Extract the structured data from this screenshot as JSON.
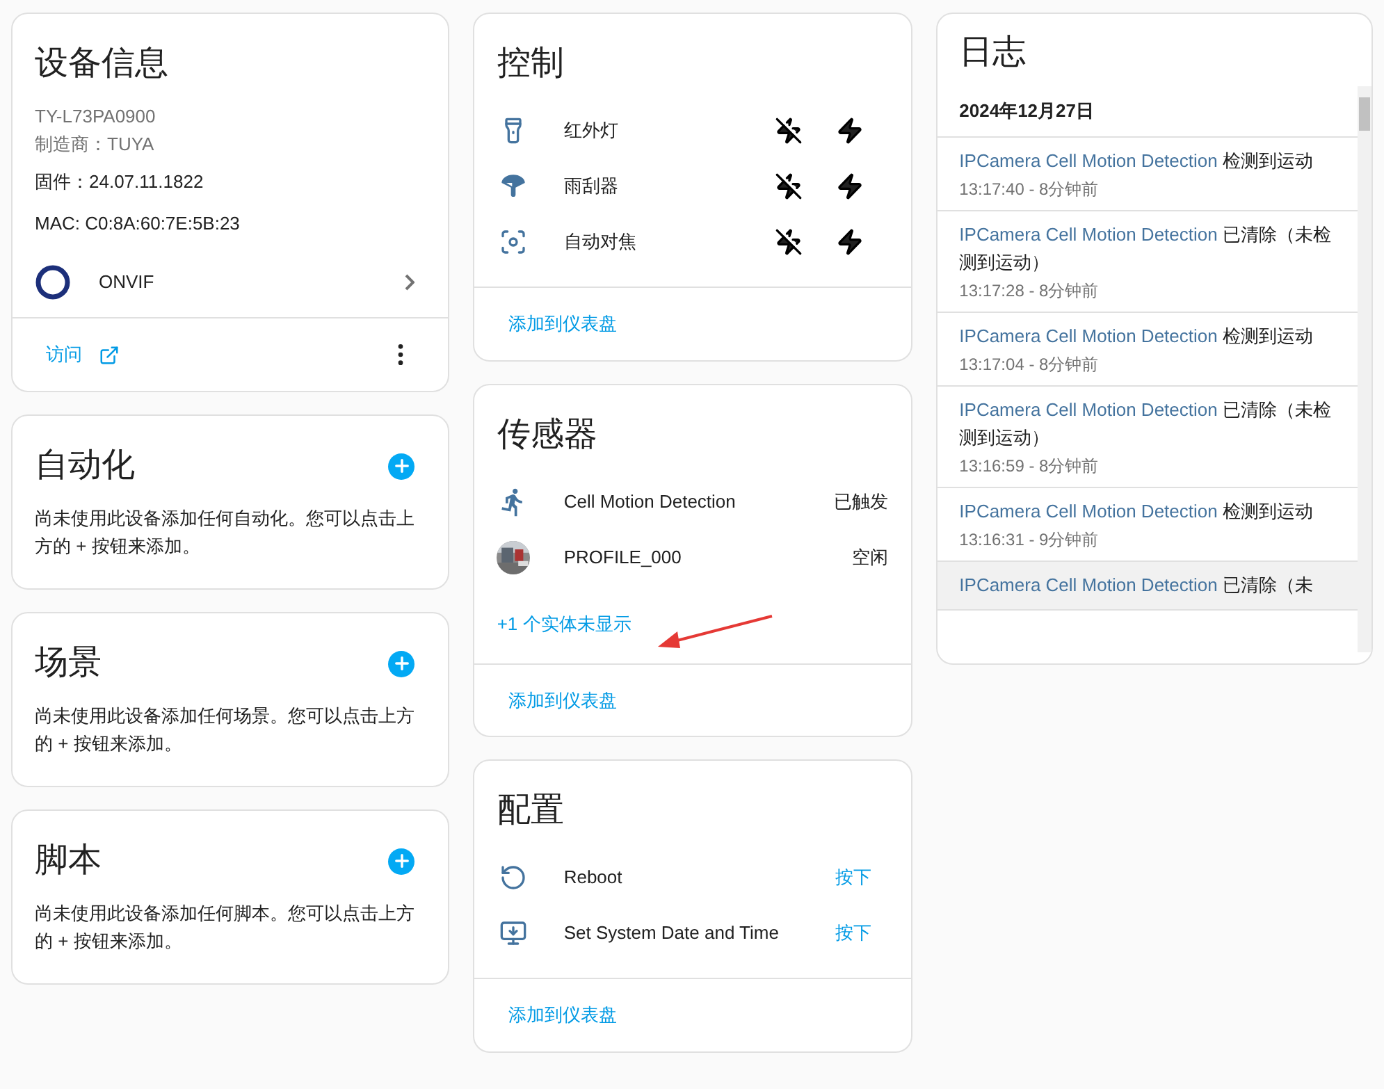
{
  "device_info": {
    "title": "设备信息",
    "model": "TY-L73PA0900",
    "manufacturer": "制造商：TUYA",
    "firmware": "固件：24.07.11.1822",
    "mac": "MAC: C0:8A:60:7E:5B:23",
    "integration": "ONVIF",
    "visit_link": "访问"
  },
  "empty_cards": [
    {
      "title": "自动化",
      "description": "尚未使用此设备添加任何自动化。您可以点击上方的 + 按钮来添加。"
    },
    {
      "title": "场景",
      "description": "尚未使用此设备添加任何场景。您可以点击上方的 + 按钮来添加。"
    },
    {
      "title": "脚本",
      "description": "尚未使用此设备添加任何脚本。您可以点击上方的 + 按钮来添加。"
    }
  ],
  "controls": {
    "title": "控制",
    "rows": [
      {
        "kind": "lamp",
        "name": "红外灯"
      },
      {
        "kind": "wiper",
        "name": "雨刮器"
      },
      {
        "kind": "focus",
        "name": "自动对焦"
      }
    ],
    "footer": "添加到仪表盘"
  },
  "sensors": {
    "title": "传感器",
    "rows": [
      {
        "kind": "motion",
        "name": "Cell Motion Detection",
        "state": "已触发"
      },
      {
        "kind": "picture",
        "name": "PROFILE_000",
        "state": "空闲"
      }
    ],
    "hidden_link": "+1 个实体未显示",
    "footer": "添加到仪表盘"
  },
  "config": {
    "title": "配置",
    "rows": [
      {
        "kind": "reboot",
        "name": "Reboot",
        "action": "按下"
      },
      {
        "kind": "datetime",
        "name": "Set System Date and Time",
        "action": "按下"
      }
    ],
    "footer": "添加到仪表盘"
  },
  "logbook": {
    "title": "日志",
    "date": "2024年12月27日",
    "entries": [
      {
        "entity": "IPCamera Cell Motion Detection",
        "message": "检测到运动",
        "time": "13:17:40 - 8分钟前",
        "highlighted": false
      },
      {
        "entity": "IPCamera Cell Motion Detection",
        "message": "已清除（未检测到运动）",
        "time": "13:17:28 - 8分钟前",
        "highlighted": false
      },
      {
        "entity": "IPCamera Cell Motion Detection",
        "message": "检测到运动",
        "time": "13:17:04 - 8分钟前",
        "highlighted": false
      },
      {
        "entity": "IPCamera Cell Motion Detection",
        "message": "已清除（未检测到运动）",
        "time": "13:16:59 - 8分钟前",
        "highlighted": false
      },
      {
        "entity": "IPCamera Cell Motion Detection",
        "message": "检测到运动",
        "time": "13:16:31 - 9分钟前",
        "highlighted": false
      },
      {
        "entity": "IPCamera Cell Motion Detection",
        "message": "已清除（未",
        "highlighted": true
      }
    ]
  }
}
